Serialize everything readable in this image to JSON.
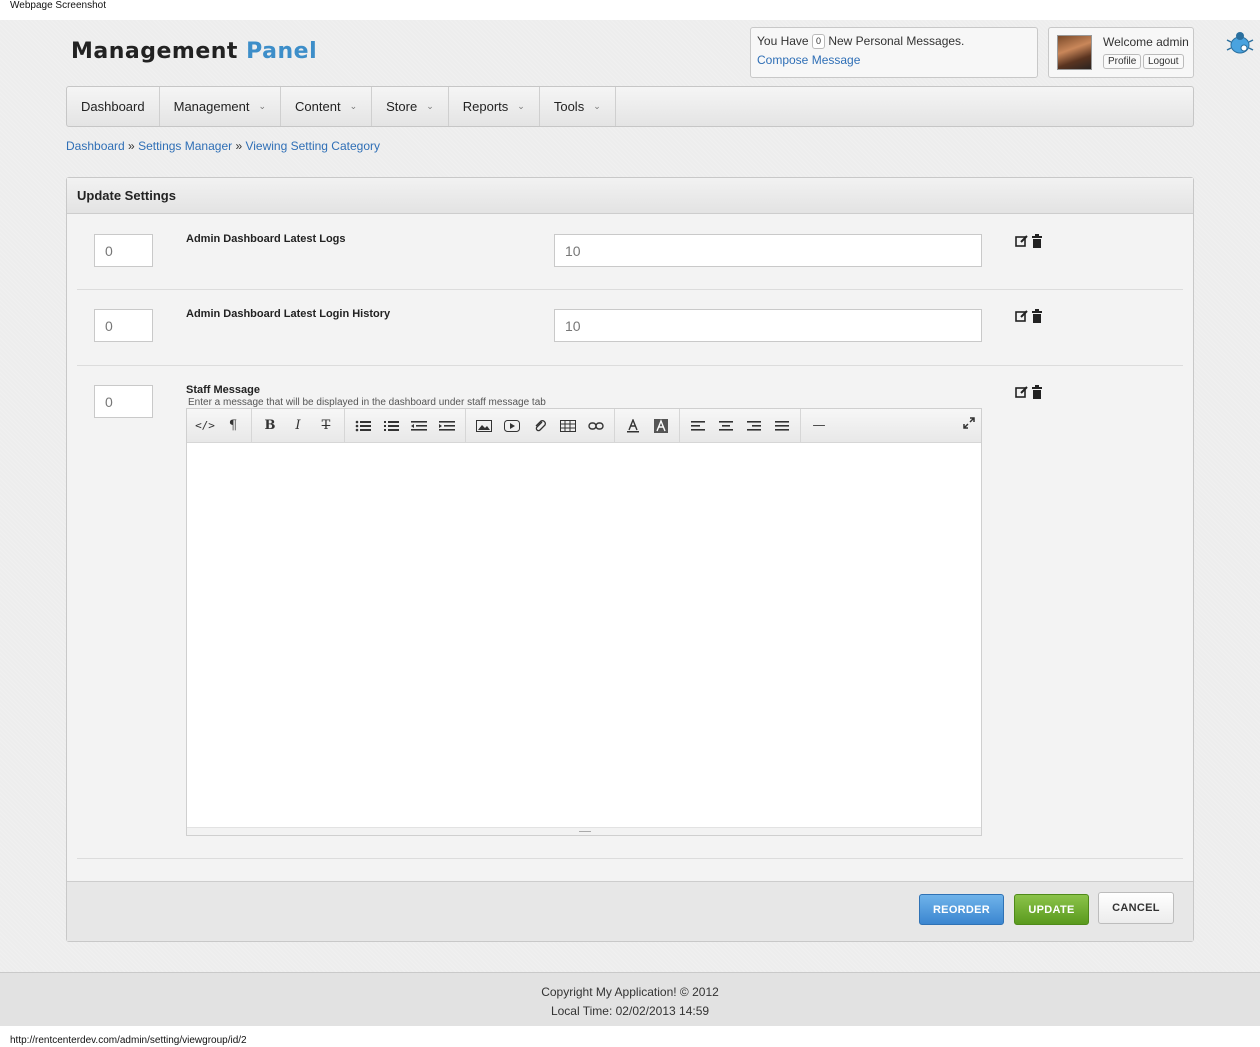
{
  "caption": "Webpage Screenshot",
  "status_url": "http://rentcenterdev.com/admin/setting/viewgroup/id/2",
  "logo": {
    "text": "Management",
    "accent": "Panel",
    "accent_color": "#3d8ec9"
  },
  "messages": {
    "prefix": "You Have",
    "count": "0",
    "suffix": "New Personal Messages.",
    "compose": "Compose Message"
  },
  "user": {
    "welcome": "Welcome admin",
    "profile": "Profile",
    "logout": "Logout"
  },
  "nav": {
    "items": [
      {
        "label": "Dashboard"
      },
      {
        "label": "Management",
        "dropdown": "⌄"
      },
      {
        "label": "Content",
        "dropdown": "⌄"
      },
      {
        "label": "Store",
        "dropdown": "⌄"
      },
      {
        "label": "Reports",
        "dropdown": "⌄"
      },
      {
        "label": "Tools",
        "dropdown": "⌄"
      }
    ]
  },
  "breadcrumb": {
    "home": "Dashboard",
    "sep": " » ",
    "section": "Settings Manager",
    "current": "Viewing Setting Category"
  },
  "panel": {
    "title": "Update Settings",
    "settings": [
      {
        "order": "0",
        "label": "Admin Dashboard Latest Logs",
        "value": "10"
      },
      {
        "order": "0",
        "label": "Admin Dashboard Latest Login History",
        "value": "10"
      },
      {
        "order": "0",
        "label": "Staff Message",
        "description": "Enter a message that will be displayed in the dashboard under staff message tab",
        "value": ""
      }
    ],
    "editor_toolbar": {
      "html": "</>",
      "paragraph": "¶",
      "bold": "B",
      "italic": "I",
      "strike": "T",
      "rule": "—"
    },
    "buttons": {
      "reorder": "REORDER",
      "update": "UPDATE",
      "cancel": "CANCEL"
    }
  },
  "footer": {
    "copyright": "Copyright My Application! © 2012",
    "local_time": "Local Time: 02/02/2013 14:59"
  }
}
